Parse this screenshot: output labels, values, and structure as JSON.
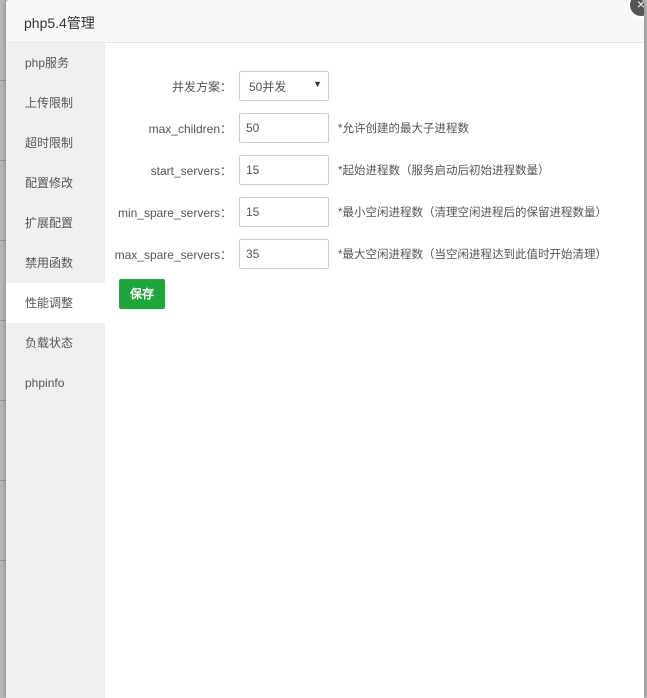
{
  "modal": {
    "title": "php5.4管理",
    "close_icon": "×"
  },
  "sidebar": {
    "items": [
      {
        "label": "php服务"
      },
      {
        "label": "上传限制"
      },
      {
        "label": "超时限制"
      },
      {
        "label": "配置修改"
      },
      {
        "label": "扩展配置"
      },
      {
        "label": "禁用函数"
      },
      {
        "label": "性能调整",
        "active": true
      },
      {
        "label": "负载状态"
      },
      {
        "label": "phpinfo"
      }
    ]
  },
  "form": {
    "concurrency": {
      "label": "并发方案：",
      "selected": "50并发"
    },
    "max_children": {
      "label": "max_children：",
      "value": "50",
      "hint": "*允许创建的最大子进程数"
    },
    "start_servers": {
      "label": "start_servers：",
      "value": "15",
      "hint": "*起始进程数（服务启动后初始进程数量）"
    },
    "min_spare_servers": {
      "label": "min_spare_servers：",
      "value": "15",
      "hint": "*最小空闲进程数（清理空闲进程后的保留进程数量）"
    },
    "max_spare_servers": {
      "label": "max_spare_servers：",
      "value": "35",
      "hint": "*最大空闲进程数（当空闲进程达到此值时开始清理）"
    },
    "save_label": "保存"
  },
  "colors": {
    "accent": "#20a53a",
    "sidebar_bg": "#f0f0f0",
    "header_bg": "#f8f8f8"
  }
}
